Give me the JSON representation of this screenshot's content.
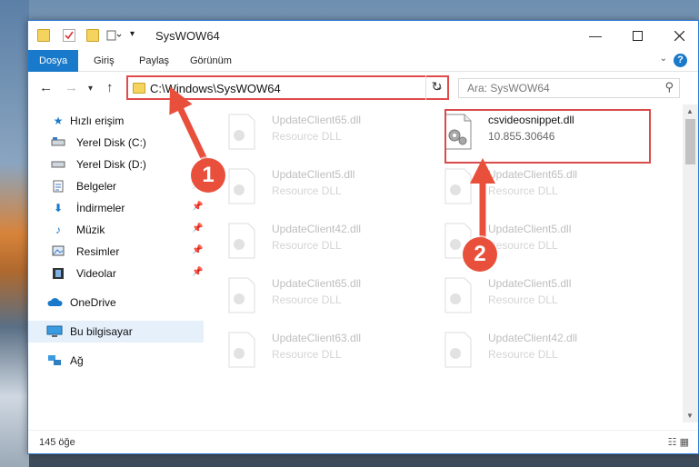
{
  "window": {
    "title": "SysWOW64"
  },
  "ribbon": {
    "tabs": [
      "Dosya",
      "Giriş",
      "Paylaş",
      "Görünüm"
    ],
    "help_label": "?"
  },
  "address": {
    "path": "C:\\Windows\\SysWOW64",
    "search_placeholder": "Ara: SysWOW64"
  },
  "sidebar": {
    "items": [
      {
        "label": "Hızlı erişim",
        "icon": "star-icon"
      },
      {
        "label": "Yerel Disk (C:)",
        "icon": "drive-icon"
      },
      {
        "label": "Yerel Disk (D:)",
        "icon": "drive-icon"
      },
      {
        "label": "Belgeler",
        "icon": "documents-icon"
      },
      {
        "label": "İndirmeler",
        "icon": "downloads-icon"
      },
      {
        "label": "Müzik",
        "icon": "music-icon"
      },
      {
        "label": "Resimler",
        "icon": "pictures-icon"
      },
      {
        "label": "Videolar",
        "icon": "videos-icon"
      },
      {
        "label": "OneDrive",
        "icon": "cloud-icon"
      },
      {
        "label": "Bu bilgisayar",
        "icon": "computer-icon"
      },
      {
        "label": "Ağ",
        "icon": "network-icon"
      }
    ]
  },
  "files": {
    "left": [
      {
        "name": "UpdateClient65.dll",
        "sub": "Resource DLL"
      },
      {
        "name": "UpdateClient5.dll",
        "sub": "Resource DLL"
      },
      {
        "name": "UpdateClient42.dll",
        "sub": "Resource DLL"
      },
      {
        "name": "UpdateClient65.dll",
        "sub": "Resource DLL"
      },
      {
        "name": "UpdateClient63.dll",
        "sub": "Resource DLL"
      }
    ],
    "right": [
      {
        "name": "csvideosnippet.dll",
        "sub": "10.855.30646"
      },
      {
        "name": "UpdateClient65.dll",
        "sub": "Resource DLL"
      },
      {
        "name": "UpdateClient5.dll",
        "sub": "Resource DLL"
      },
      {
        "name": "UpdateClient5.dll",
        "sub": "Resource DLL"
      },
      {
        "name": "UpdateClient42.dll",
        "sub": "Resource DLL"
      }
    ]
  },
  "status": {
    "item_count": "145 öğe"
  },
  "callouts": {
    "first": "1",
    "second": "2"
  },
  "colors": {
    "accent": "#1979ca",
    "highlight_red": "#e04a4a",
    "callout_red": "#e8503c"
  }
}
